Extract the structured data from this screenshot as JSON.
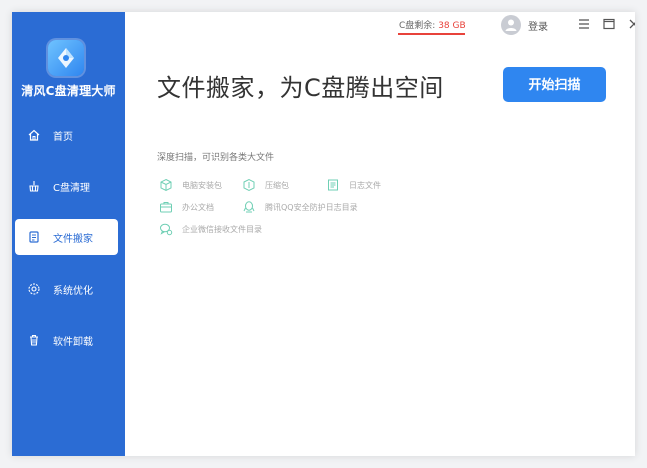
{
  "app": {
    "name": "清风C盘清理大师"
  },
  "nav": {
    "items": [
      {
        "label": "首页",
        "icon": "home-icon"
      },
      {
        "label": "C盘清理",
        "icon": "broom-icon"
      },
      {
        "label": "文件搬家",
        "icon": "file-move-icon"
      },
      {
        "label": "系统优化",
        "icon": "gear-icon"
      },
      {
        "label": "软件卸载",
        "icon": "trash-icon"
      }
    ],
    "active_index": 2
  },
  "titlebar": {
    "disk_label": "C盘剩余:",
    "disk_value": "38 GB",
    "login_label": "登录"
  },
  "main": {
    "heading": "文件搬家，为C盘腾出空间",
    "scan_button": "开始扫描",
    "subheading": "深度扫描，可识别各类大文件",
    "categories": [
      {
        "label": "电脑安装包",
        "icon": "package-icon"
      },
      {
        "label": "压缩包",
        "icon": "archive-icon"
      },
      {
        "label": "日志文件",
        "icon": "log-file-icon"
      },
      {
        "label": "办公文档",
        "icon": "briefcase-icon"
      },
      {
        "label": "腾讯QQ安全防护日志目录",
        "icon": "qq-icon"
      },
      {
        "label": "企业微信接收文件目录",
        "icon": "wechat-icon"
      }
    ]
  },
  "colors": {
    "sidebar": "#2b6cd4",
    "accent": "#2f86f0",
    "warning": "#e8433b"
  }
}
